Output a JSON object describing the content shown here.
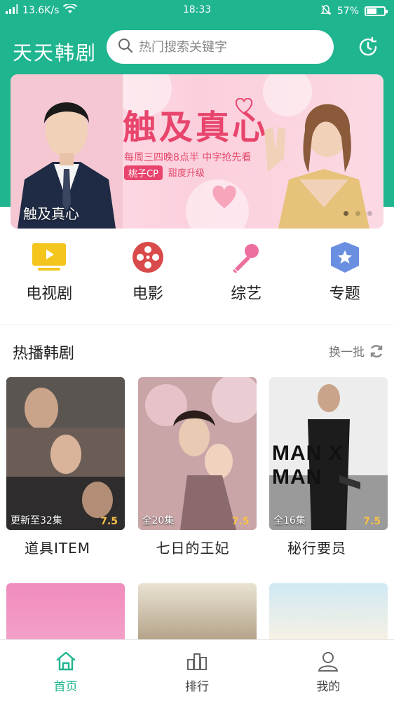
{
  "status_bar": {
    "network": "13.6K/s",
    "time": "18:33",
    "battery": "57%",
    "battery_level": 0.57
  },
  "header": {
    "app_title": "天天韩剧",
    "search_placeholder": "热门搜索关键字"
  },
  "banner": {
    "headline": "触及真心",
    "subtitle": "每周三四晚8点半 中字抢先看",
    "tag": "桃子CP",
    "tag_extra": "甜度升级",
    "caption": "触及真心"
  },
  "categories": [
    {
      "label": "电视剧",
      "icon": "tv-icon",
      "color": "#f4c51c"
    },
    {
      "label": "电影",
      "icon": "film-reel-icon",
      "color": "#d94a4a"
    },
    {
      "label": "综艺",
      "icon": "microphone-icon",
      "color": "#ec6fa0"
    },
    {
      "label": "专题",
      "icon": "star-badge-icon",
      "color": "#6b8fe0"
    }
  ],
  "section": {
    "title": "热播韩剧",
    "refresh_label": "换一批"
  },
  "dramas": [
    {
      "title": "道具ITEM",
      "episodes": "更新至32集",
      "score": "7.5"
    },
    {
      "title": "七日的王妃",
      "episodes": "全20集",
      "score": "7.5"
    },
    {
      "title": "秘行要员",
      "episodes": "全16集",
      "score": "7.5",
      "poster_text": "MAN X MAN"
    }
  ],
  "tabbar": [
    {
      "label": "首页",
      "icon": "home-icon",
      "active": true
    },
    {
      "label": "排行",
      "icon": "ranking-icon",
      "active": false
    },
    {
      "label": "我的",
      "icon": "profile-icon",
      "active": false
    }
  ],
  "colors": {
    "brand": "#1fb58f",
    "score": "#f7c04a"
  }
}
